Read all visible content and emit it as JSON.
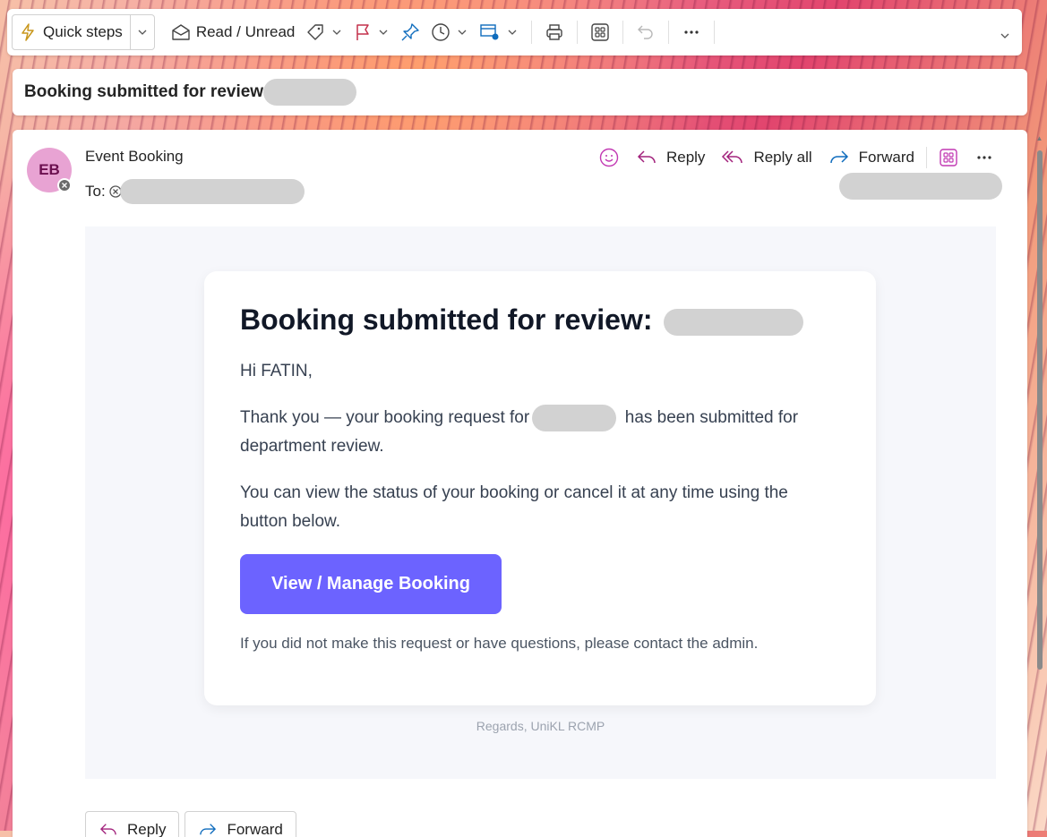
{
  "ribbon": {
    "quick_steps": "Quick steps",
    "read_unread": "Read / Unread"
  },
  "subject": {
    "title": "Booking submitted for review:"
  },
  "message": {
    "avatar_initials": "EB",
    "sender": "Event Booking",
    "to_label": "To:",
    "actions": {
      "reply": "Reply",
      "reply_all": "Reply all",
      "forward": "Forward"
    }
  },
  "email": {
    "heading": "Booking submitted for review:",
    "greeting": "Hi FATIN,",
    "para1_a": "Thank you — your booking request for",
    "para1_b": "has been submitted for department review.",
    "para2": "You can view the status of your booking or cancel it at any time using the button below.",
    "button": "View / Manage Booking",
    "note": "If you did not make this request or have questions, please contact the admin.",
    "regards": "Regards, UniKL RCMP"
  },
  "footer": {
    "reply": "Reply",
    "forward": "Forward"
  },
  "colors": {
    "accent_button": "#6c63ff",
    "avatar_bg": "#e8a3d3",
    "reply_icon": "#a2227c",
    "forward_icon": "#0f6cbd"
  }
}
